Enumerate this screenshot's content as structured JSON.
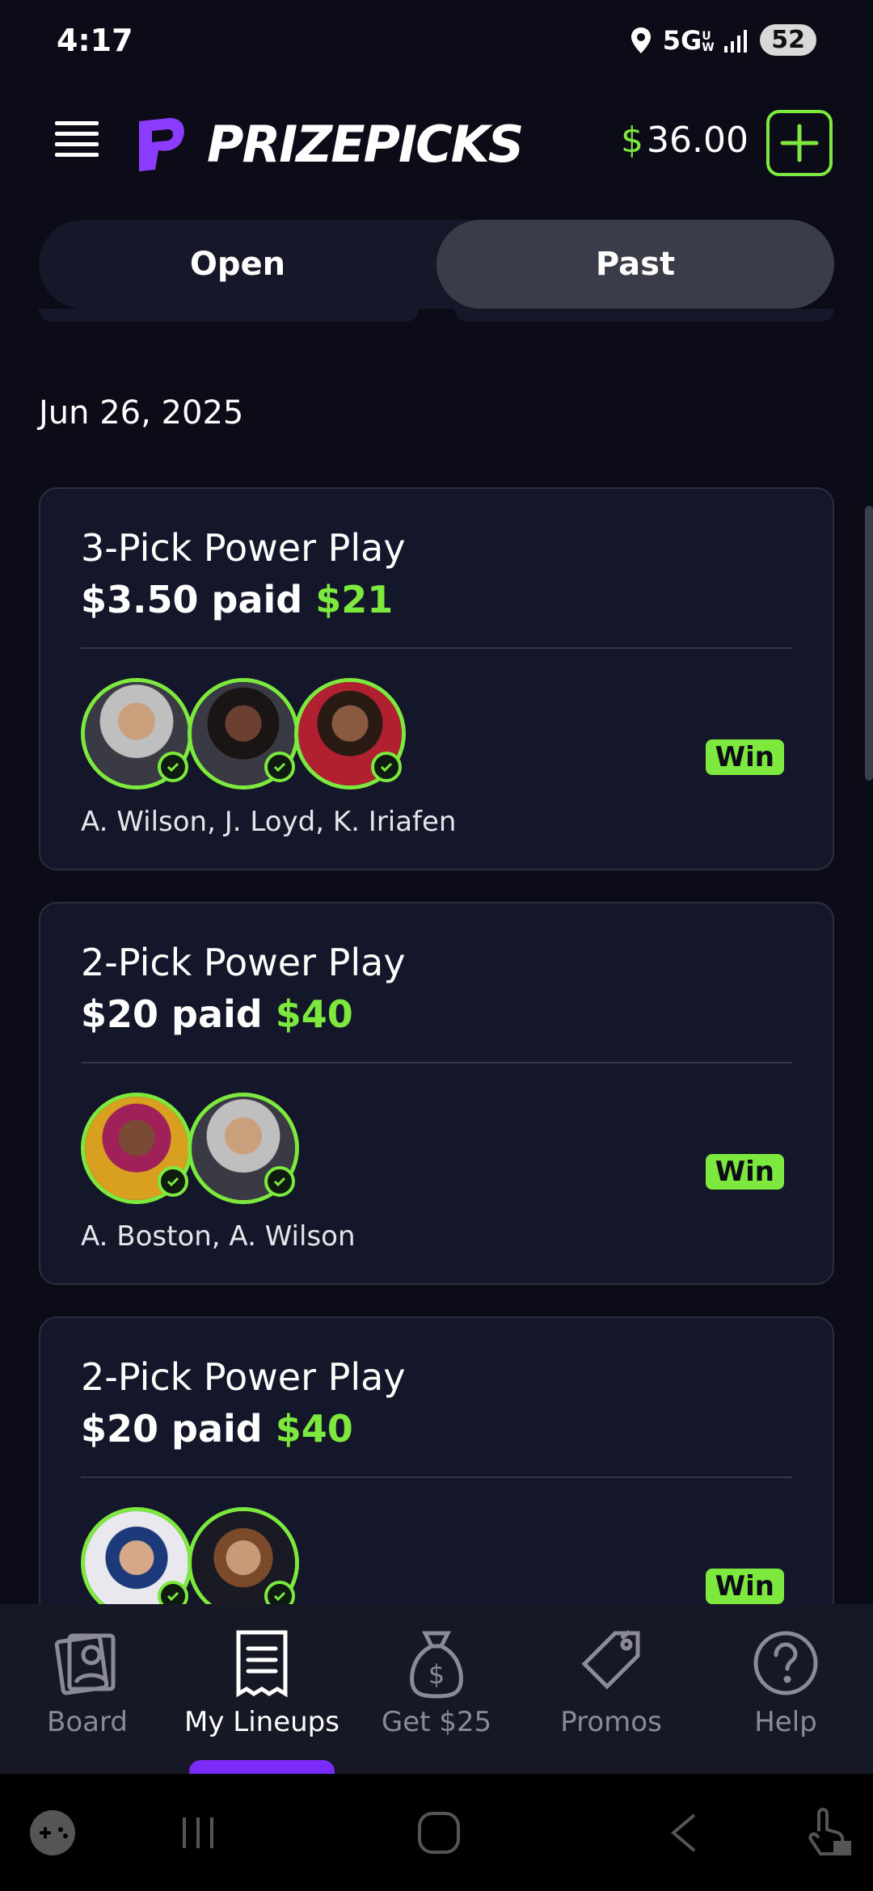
{
  "status_bar": {
    "time": "4:17",
    "network": "5G",
    "network_sub": "UW",
    "battery": "52",
    "icons": [
      "location-icon",
      "signal-icon"
    ]
  },
  "header": {
    "logo_text": "PRIZEPICKS",
    "balance_currency": "$",
    "balance_amount": "36.00",
    "accent": "#7de83d",
    "brand": "#7b2bf9"
  },
  "tabs": [
    {
      "label": "Open",
      "selected": false
    },
    {
      "label": "Past",
      "selected": true
    }
  ],
  "date_header": "Jun 26, 2025",
  "lineups": [
    {
      "title": "3-Pick Power Play",
      "paid_prefix": "$3.50 paid",
      "paid_amount": "$21",
      "players": "A. Wilson, J. Loyd, K. Iriafen",
      "result": "Win"
    },
    {
      "title": "2-Pick Power Play",
      "paid_prefix": "$20 paid",
      "paid_amount": "$40",
      "players": "A. Boston, A. Wilson",
      "result": "Win"
    },
    {
      "title": "2-Pick Power Play",
      "paid_prefix": "$20 paid",
      "paid_amount": "$40",
      "players": "",
      "result": "Win"
    }
  ],
  "bottom_nav": [
    {
      "label": "Board",
      "icon": "board-icon",
      "active": false
    },
    {
      "label": "My Lineups",
      "icon": "lineups-icon",
      "active": true
    },
    {
      "label": "Get $25",
      "icon": "money-bag-icon",
      "active": false
    },
    {
      "label": "Promos",
      "icon": "tag-icon",
      "active": false
    },
    {
      "label": "Help",
      "icon": "help-icon",
      "active": false
    }
  ]
}
